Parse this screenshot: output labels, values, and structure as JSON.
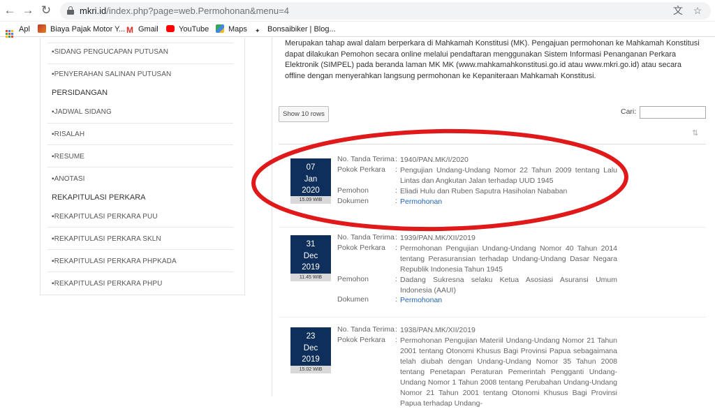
{
  "browser": {
    "url_host": "mkri.id",
    "url_path": "/index.php?page=web.Permohonan&menu=4",
    "bookmarks": [
      {
        "label": "Apl",
        "icon": "apps-grid-icon"
      },
      {
        "label": "Biaya Pajak Motor Y...",
        "icon": "bookmark-favicon"
      },
      {
        "label": "Gmail",
        "icon": "gmail-icon"
      },
      {
        "label": "YouTube",
        "icon": "youtube-icon"
      },
      {
        "label": "Maps",
        "icon": "maps-icon"
      },
      {
        "label": "Bonsaibiker | Blog...",
        "icon": "bonsaibiker-icon"
      }
    ]
  },
  "sidebar": {
    "items_top": [
      "▪SIDANG PENGUCAPAN PUTUSAN",
      "▪PENYERAHAN SALINAN PUTUSAN"
    ],
    "section_persidangan": "PERSIDANGAN",
    "items_persidangan": [
      "▪JADWAL SIDANG",
      "▪RISALAH",
      "▪RESUME",
      "▪ANOTASI"
    ],
    "section_rekap": "REKAPITULASI PERKARA",
    "items_rekap": [
      "▪REKAPITULASI PERKARA PUU",
      "▪REKAPITULASI PERKARA SKLN",
      "▪REKAPITULASI PERKARA PHPKADA",
      "▪REKAPITULASI PERKARA PHPU"
    ]
  },
  "main": {
    "intro": "Merupakan tahap awal dalam berperkara di Mahkamah Konstitusi (MK). Pengajuan permohonan ke Mahkamah Konstitusi dapat dilakukan Pemohon secara online melalui pendaftaran menggunakan Sistem Informasi Penanganan Perkara Elektronik (SIMPEL) pada beranda laman MK MK (www.mahkamahkonstitusi.go.id atau www.mkri.go.id) atau secara offline dengan menyerahkan langsung permohonan ke Kepaniteraan Mahkamah Konstitusi.",
    "show_rows": "Show 10 rows",
    "search_label": "Cari:",
    "search_value": "",
    "labels": {
      "no": "No. Tanda Terima",
      "pokok": "Pokok Perkara",
      "pemohon": "Pemohon",
      "dokumen": "Dokumen",
      "colon": ":"
    },
    "entries": [
      {
        "day": "07",
        "month": "Jan",
        "year": "2020",
        "time": "15.09 WIB",
        "no": "1940/PAN.MK/I/2020",
        "pokok": "Pengujian Undang-Undang Nomor 22 Tahun 2009 tentang Lalu Lintas dan Angkutan Jalan terhadap UUD 1945",
        "pemohon": "Eliadi Hulu dan Ruben Saputra Hasiholan Nababan",
        "dokumen": "Permohonan"
      },
      {
        "day": "31",
        "month": "Dec",
        "year": "2019",
        "time": "11.45 WIB",
        "no": "1939/PAN.MK/XII/2019",
        "pokok": "Permohonan Pengujian Undang-Undang Nomor 40 Tahun 2014 tentang Perasuransian terhadap Undang-Undang Dasar Negara Republik Indonesia Tahun 1945",
        "pemohon": "Dadang Sukresna selaku Ketua Asosiasi Asuransi Umum Indonesia (AAUI)",
        "dokumen": "Permohonan"
      },
      {
        "day": "23",
        "month": "Dec",
        "year": "2019",
        "time": "15.02 WIB",
        "no": "1938/PAN.MK/XII/2019",
        "pokok": "Permohonan Pengujian Materiil Undang-Undang Nomor 21 Tahun 2001 tentang Otonomi Khusus Bagi Provinsi Papua sebagaimana telah diubah dengan Undang-Undang Nomor 35 Tahun 2008 tentang Penetapan Peraturan Pemerintah Pengganti Undang-Undang Nomor 1 Tahun 2008 tentang Perubahan Undang-Undang Nomor 21 Tahun 2001 tentang Otonomi Khusus Bagi Provinsi Papua terhadap Undang-"
      }
    ]
  },
  "colors": {
    "navy": "#0e2f5c",
    "link": "#1e63b4",
    "annotation_red": "#e0191b"
  }
}
